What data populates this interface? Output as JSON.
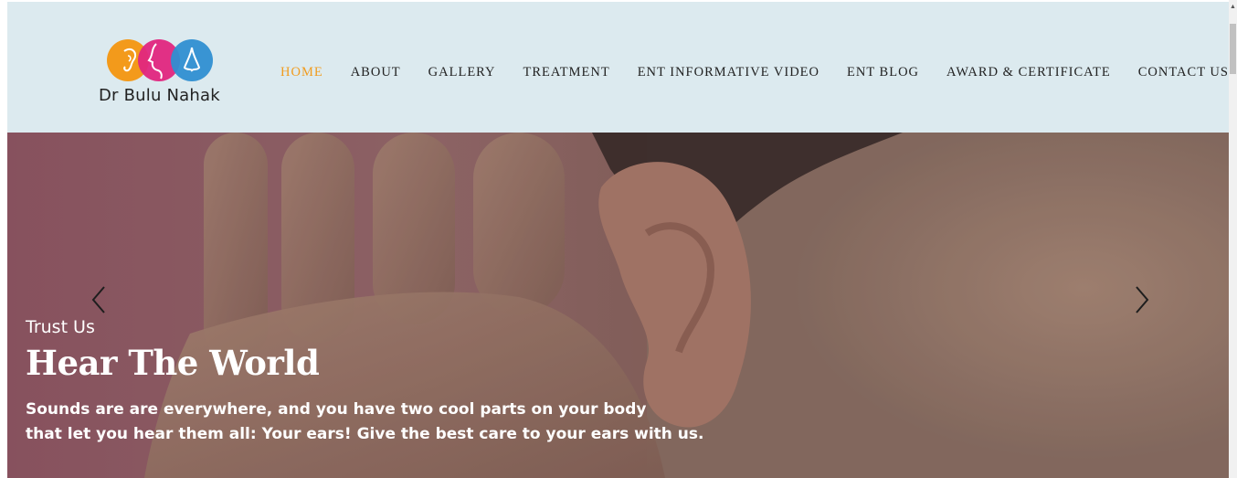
{
  "brand": {
    "name": "Dr Bulu Nahak",
    "logo_colors": [
      "#f39a1b",
      "#e0267e",
      "#2f8fd1"
    ]
  },
  "nav": {
    "items": [
      {
        "label": "HOME",
        "active": true
      },
      {
        "label": "ABOUT"
      },
      {
        "label": "GALLERY"
      },
      {
        "label": "TREATMENT"
      },
      {
        "label": "ENT INFORMATIVE VIDEO"
      },
      {
        "label": "ENT BLOG"
      },
      {
        "label": "AWARD & CERTIFICATE"
      },
      {
        "label": "CONTACT US"
      }
    ],
    "active_color": "#f19c1e",
    "text_color": "#222222"
  },
  "header": {
    "background": "#dceaef"
  },
  "hero": {
    "eyebrow": "Trust Us",
    "title": "Hear The World",
    "text_line1": "Sounds are are everywhere, and you have two cool parts on your body",
    "text_line2": "that let you hear them all: Your ears! Give the best care to your ears with us.",
    "prev_icon": "chevron-left-icon",
    "next_icon": "chevron-right-icon",
    "image": "woman-cupping-hand-to-ear-photo"
  },
  "scrollbar": {
    "up_icon": "triangle-up-icon"
  }
}
